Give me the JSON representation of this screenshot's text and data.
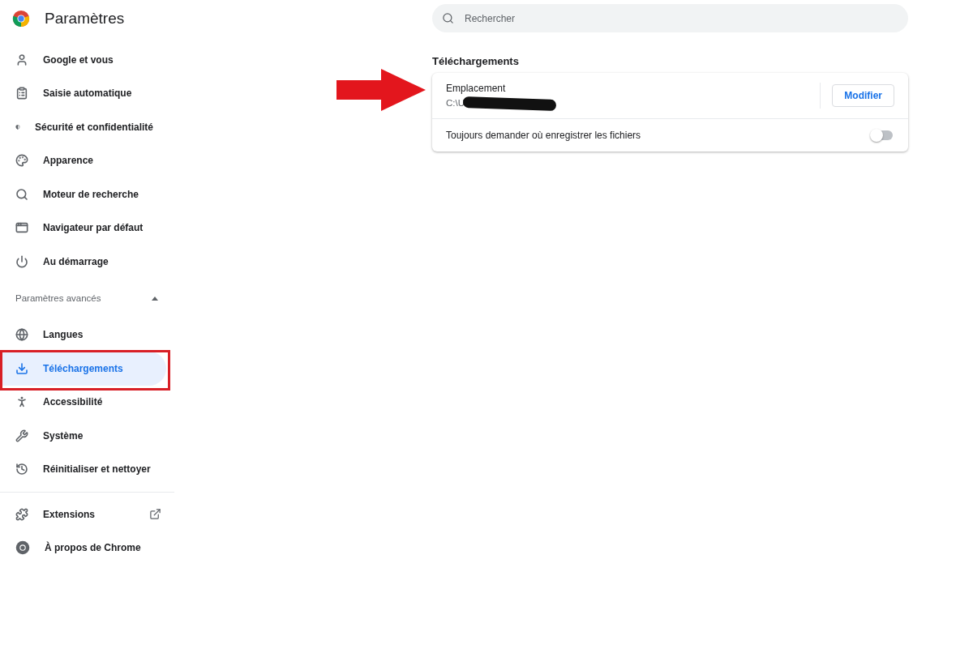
{
  "header": {
    "title": "Paramètres"
  },
  "search": {
    "placeholder": "Rechercher"
  },
  "sidebar": {
    "items": [
      {
        "label": "Google et vous",
        "selected": false
      },
      {
        "label": "Saisie automatique",
        "selected": false
      },
      {
        "label": "Sécurité et confidentialité",
        "selected": false
      },
      {
        "label": "Apparence",
        "selected": false
      },
      {
        "label": "Moteur de recherche",
        "selected": false
      },
      {
        "label": "Navigateur par défaut",
        "selected": false
      },
      {
        "label": "Au démarrage",
        "selected": false
      }
    ],
    "advanced": {
      "label": "Paramètres avancés",
      "expanded": true,
      "items": [
        {
          "label": "Langues",
          "selected": false
        },
        {
          "label": "Téléchargements",
          "selected": true
        },
        {
          "label": "Accessibilité",
          "selected": false
        },
        {
          "label": "Système",
          "selected": false
        },
        {
          "label": "Réinitialiser et nettoyer",
          "selected": false
        }
      ]
    },
    "footer_items": [
      {
        "label": "Extensions",
        "external": true
      },
      {
        "label": "À propos de Chrome",
        "external": false
      }
    ]
  },
  "section": {
    "title": "Téléchargements",
    "location": {
      "label": "Emplacement",
      "path": "C:\\U",
      "redacted": true,
      "button": "Modifier"
    },
    "ask_toggle": {
      "label": "Toujours demander où enregistrer les fichiers",
      "on": false
    }
  },
  "annotations": {
    "highlight_selected": true,
    "arrow": true
  }
}
